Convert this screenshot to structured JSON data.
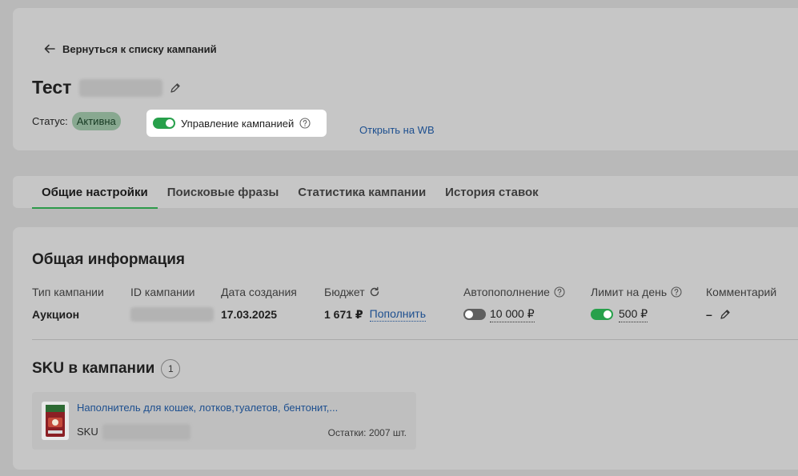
{
  "header": {
    "back_label": "Вернуться к списку кампаний",
    "title": "Тест",
    "status_label": "Статус:",
    "status_value": "Активна",
    "manage_label": "Управление кампанией",
    "open_wb_label": "Открыть на WB"
  },
  "tabs": [
    {
      "label": "Общие настройки",
      "active": true
    },
    {
      "label": "Поисковые фразы",
      "active": false
    },
    {
      "label": "Статистика кампании",
      "active": false
    },
    {
      "label": "История ставок",
      "active": false
    }
  ],
  "general": {
    "title": "Общая информация",
    "fields": {
      "type": {
        "label": "Тип кампании",
        "value": "Аукцион"
      },
      "id": {
        "label": "ID кампании"
      },
      "created": {
        "label": "Дата создания",
        "value": "17.03.2025"
      },
      "budget": {
        "label": "Бюджет",
        "value": "1 671 ₽",
        "action": "Пополнить"
      },
      "autorefill": {
        "label": "Автопополнение",
        "value": "10 000 ₽",
        "enabled": false
      },
      "daily_limit": {
        "label": "Лимит на день",
        "value": "500 ₽",
        "enabled": true
      },
      "comment": {
        "label": "Комментарий",
        "value": "–"
      }
    }
  },
  "sku": {
    "title": "SKU в кампании",
    "count": "1",
    "items": [
      {
        "name": "Наполнитель для кошек, лотков,туалетов, бентонит,...",
        "sku_label": "SKU",
        "stock": "Остатки: 2007 шт."
      }
    ]
  },
  "colors": {
    "accent_green": "#27a04b",
    "link_blue": "#1d4f8f"
  }
}
